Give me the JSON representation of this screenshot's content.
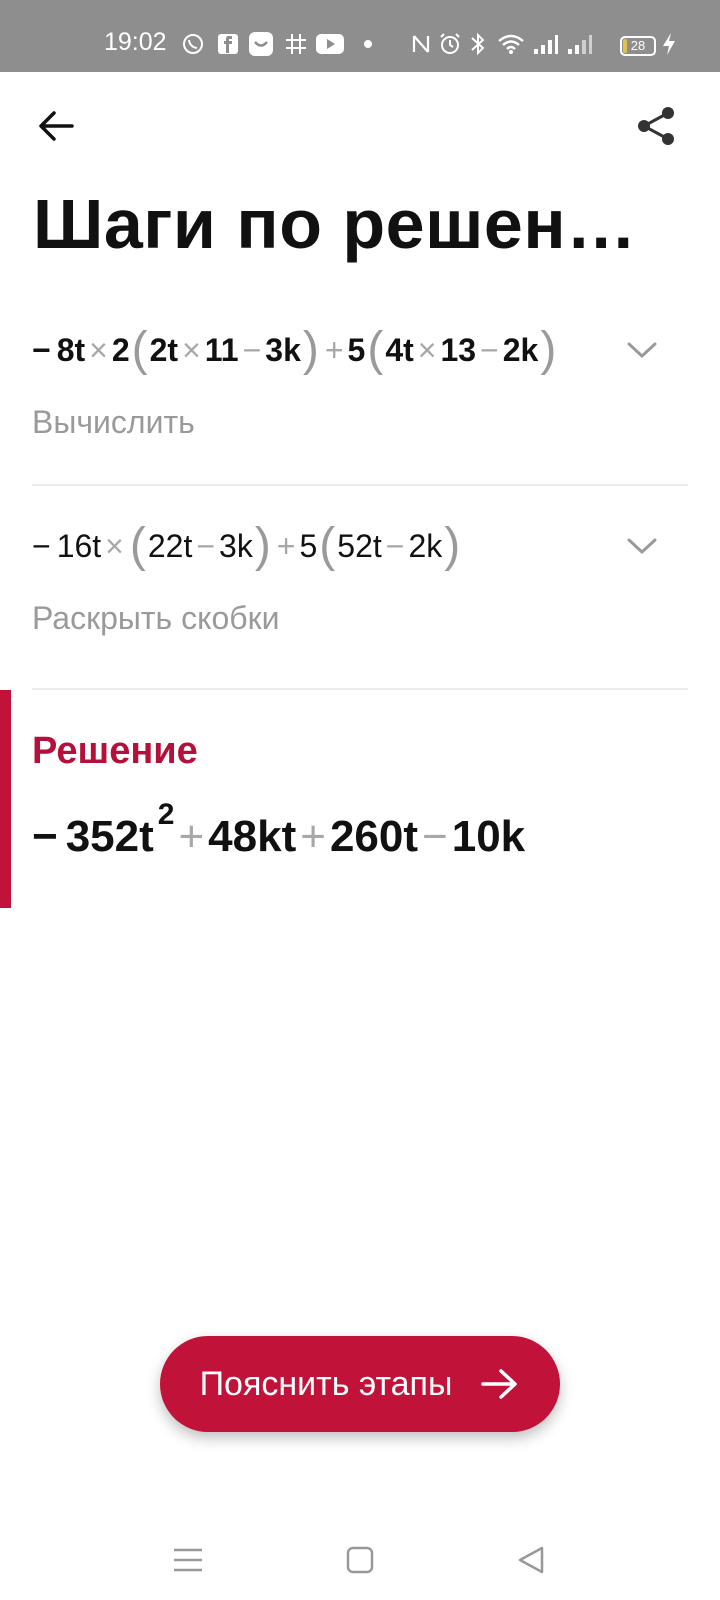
{
  "status_bar": {
    "time": "19:02",
    "battery": "28",
    "icons": [
      "viber-icon",
      "facebook-icon",
      "messenger-icon",
      "grid-icon",
      "youtube-icon",
      "dot-icon",
      "nfc-icon",
      "alarm-icon",
      "bluetooth-icon",
      "wifi-icon",
      "signal-icon",
      "signal-icon-2",
      "battery-icon",
      "charging-icon"
    ]
  },
  "header": {
    "title": "Шаги по решен…",
    "back_icon": "arrow-left-icon",
    "share_icon": "share-icon"
  },
  "steps": [
    {
      "parts": [
        "−",
        "8t",
        "×",
        "2",
        "(",
        "2t",
        "×",
        "11",
        "−",
        "3k",
        ")",
        "+",
        "5",
        "(",
        "4t",
        "×",
        "13",
        "−",
        "2k",
        ")"
      ],
      "caption": "Вычислить"
    },
    {
      "parts": [
        "−",
        "16t",
        "×",
        "(",
        "22t",
        "−",
        "3k",
        ")",
        "+",
        "5",
        "(",
        "52t",
        "−",
        "2k",
        ")"
      ],
      "caption": "Раскрыть скобки"
    }
  ],
  "solution": {
    "title": "Решение",
    "minus": "−",
    "term1": "352t",
    "exp": "2",
    "plus1": "+",
    "term2": "48kt",
    "plus2": "+",
    "term3": "260t",
    "minus2": "−",
    "term4": "10k"
  },
  "explain_button": {
    "label": "Пояснить этапы"
  },
  "colors": {
    "accent": "#c1123a",
    "status_bar": "#8e8e8e",
    "muted_text": "#9a9a9a"
  }
}
